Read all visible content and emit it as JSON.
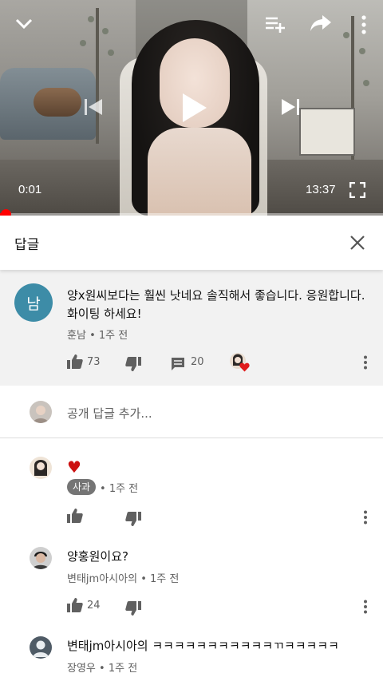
{
  "player": {
    "current_time": "0:01",
    "duration": "13:37",
    "progress": 0.0012
  },
  "header": {
    "title": "답글"
  },
  "parent_comment": {
    "avatar_letter": "남",
    "avatar_color": "#3d8ca7",
    "text_line1": "양x원씨보다는 훨씬 낫네요 솔직해서 좋습니다. 응원합니다.",
    "text_line2": "화이팅 하세요!",
    "author": "훈남",
    "age": "1주 전",
    "likes": "73",
    "replies": "20"
  },
  "add_reply": {
    "placeholder": "공개 답글 추가..."
  },
  "replies": [
    {
      "text": "♥",
      "author": "사과",
      "age": "1주 전",
      "likes": ""
    },
    {
      "text": "양홍원이요?",
      "author": "변태jm아시아의",
      "age": "1주 전",
      "likes": "24"
    },
    {
      "text": "변태jm아시아의 ㅋㅋㅋㅋㅋㅋㅋㅋㅋㅋㅋㄲㅋㅋㅋㅋㅋ",
      "author": "장영우",
      "age": "1주 전"
    }
  ],
  "colors": {
    "accent_red": "#ff0000",
    "heart_red": "#cc1111",
    "meta_gray": "#606060"
  }
}
